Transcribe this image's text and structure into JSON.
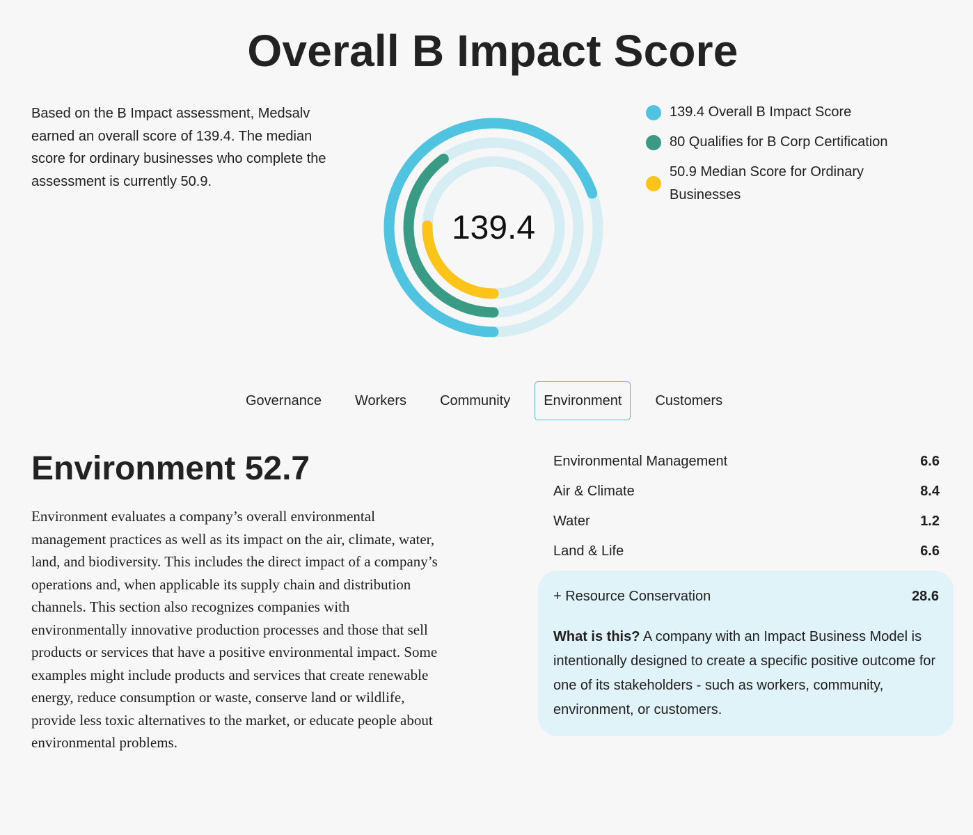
{
  "header": {
    "title": "Overall B Impact Score"
  },
  "intro": {
    "text": "Based on the B Impact assessment, Medsalv earned an overall score of 139.4. The median score for ordinary businesses who complete the assessment is currently 50.9."
  },
  "score_rings": {
    "center_label": "139.4",
    "max": 200,
    "track_color": "#d6edf3",
    "rings": [
      {
        "value": 139.4,
        "color": "#4fc3e0"
      },
      {
        "value": 80,
        "color": "#3a9b85"
      },
      {
        "value": 50.9,
        "color": "#fcc419"
      }
    ]
  },
  "legend": {
    "items": [
      {
        "label": "139.4 Overall B Impact Score",
        "color": "#4fc3e0"
      },
      {
        "label": "80 Qualifies for B Corp Certification",
        "color": "#3a9b85"
      },
      {
        "label": "50.9 Median Score for Ordinary Businesses",
        "color": "#fcc419"
      }
    ]
  },
  "tabs": {
    "items": [
      {
        "label": "Governance"
      },
      {
        "label": "Workers"
      },
      {
        "label": "Community"
      },
      {
        "label": "Environment"
      },
      {
        "label": "Customers"
      }
    ],
    "active": "Environment"
  },
  "section": {
    "title": "Environment 52.7",
    "description": "Environment evaluates a company’s overall environmental management practices as well as its impact on the air, climate, water, land, and biodiversity. This includes the direct impact of a company’s operations and, when applicable its supply chain and distribution channels. This section also recognizes companies with environmentally innovative production processes and those that sell products or services that have a positive environmental impact. Some examples might include products and services that create renewable energy, reduce consumption or waste, conserve land or wildlife, provide less toxic alternatives to the market, or educate people about environmental problems."
  },
  "scores": {
    "rows": [
      {
        "label": "Environmental Management",
        "value": "6.6"
      },
      {
        "label": "Air & Climate",
        "value": "8.4"
      },
      {
        "label": "Water",
        "value": "1.2"
      },
      {
        "label": "Land & Life",
        "value": "6.6"
      }
    ]
  },
  "info_card": {
    "label": "+ Resource Conservation",
    "value": "28.6",
    "question": "What is this?",
    "answer": " A company with an Impact Business Model is intentionally designed to create a specific positive outcome for one of its stakeholders - such as workers, community, environment, or customers."
  }
}
